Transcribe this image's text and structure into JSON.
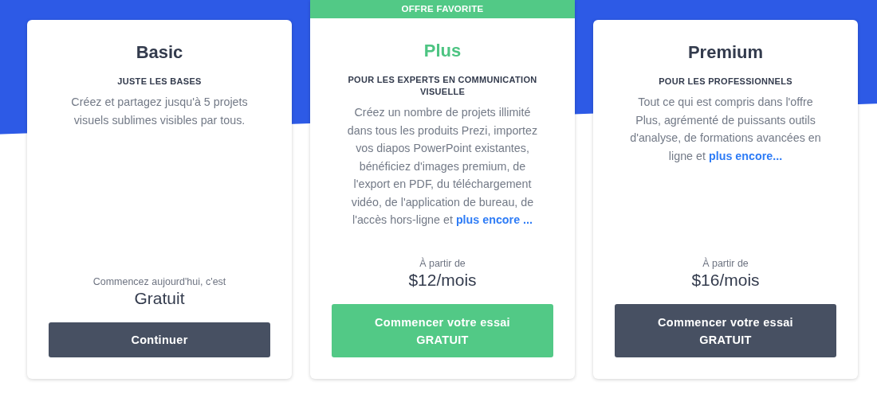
{
  "plans": [
    {
      "name": "Basic",
      "highlighted": false,
      "subtitle": "JUSTE LES BASES",
      "description": "Créez et partagez jusqu'à 5 projets visuels sublimes visibles par tous.",
      "price_prefix": "Commencez aujourd'hui, c'est",
      "price": "Gratuit",
      "button": "Continuer"
    },
    {
      "name": "Plus",
      "highlighted": true,
      "ribbon": "OFFRE FAVORITE",
      "subtitle": "POUR LES EXPERTS EN COMMUNICATION VISUELLE",
      "description": "Créez un nombre de projets illimité dans tous les produits Prezi, importez vos diapos PowerPoint existantes, bénéficiez d'images premium, de l'export en PDF, du téléchargement vidéo, de l'application de bureau, de l'accès hors-ligne et",
      "link": "plus encore ...",
      "price_prefix": "À partir de",
      "price": "$12/mois",
      "button": "Commencer votre essai GRATUIT"
    },
    {
      "name": "Premium",
      "highlighted": false,
      "subtitle": "POUR LES PROFESSIONNELS",
      "description": "Tout ce qui est compris dans l'offre Plus, agrémenté de puissants outils d'analyse, de formations avancées en ligne et",
      "link": "plus encore...",
      "price_prefix": "À partir de",
      "price": "$16/mois",
      "button": "Commencer votre essai GRATUIT"
    }
  ]
}
